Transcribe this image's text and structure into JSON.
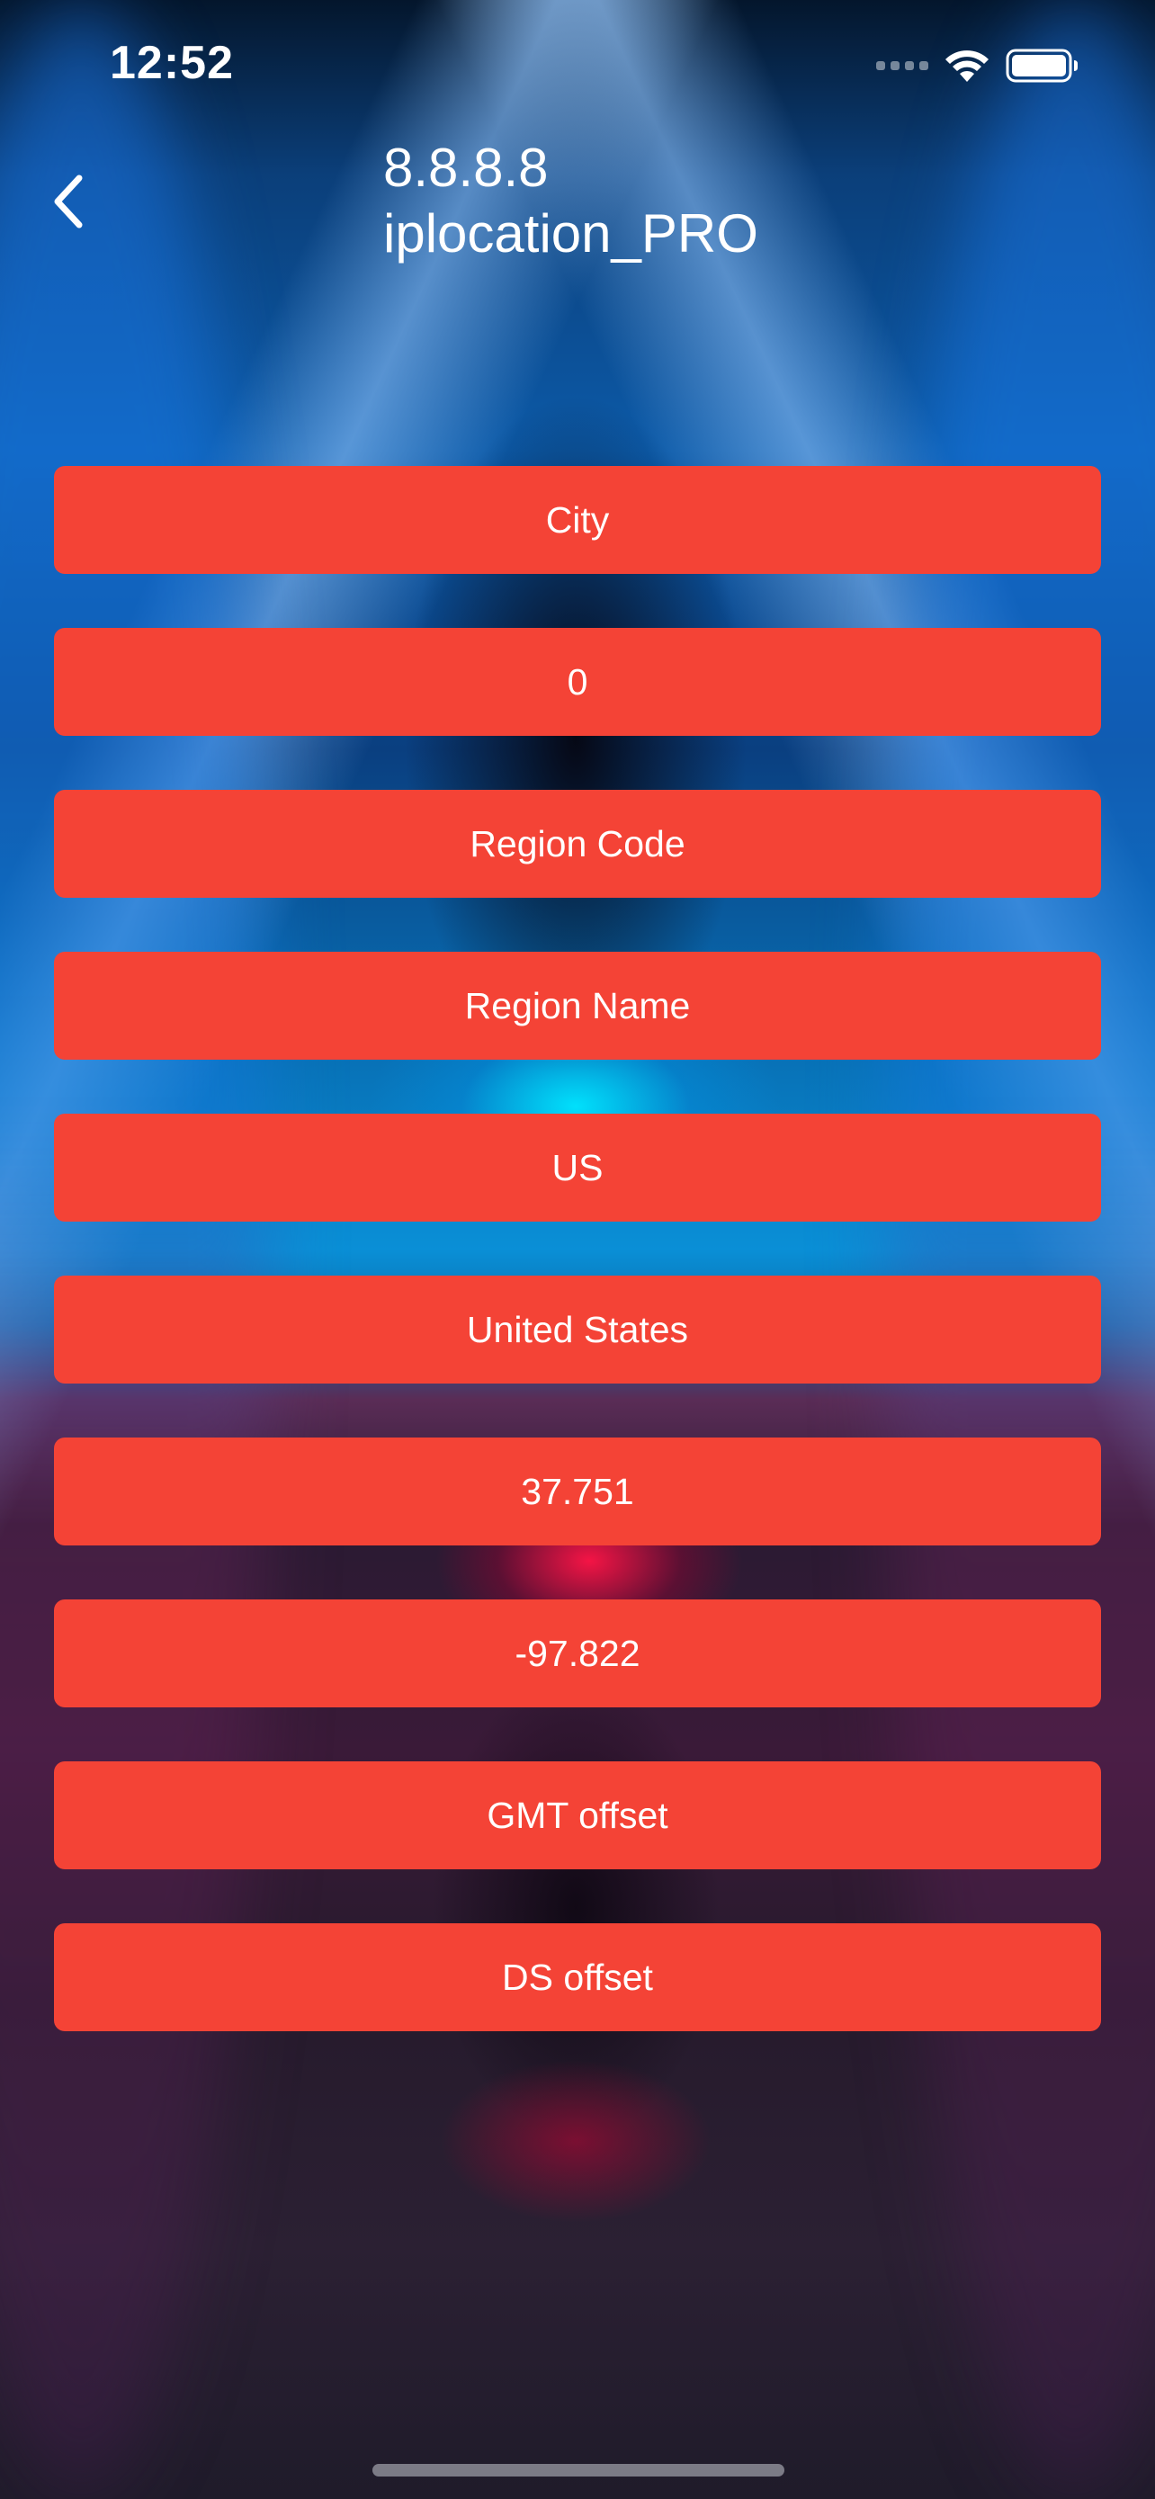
{
  "status_bar": {
    "time": "12:52",
    "icons": [
      "signal-icon",
      "wifi-icon",
      "battery-icon"
    ]
  },
  "header": {
    "back_icon": "chevron-left-icon",
    "title_line1": "8.8.8.8",
    "title_line2": "iplocation_PRO"
  },
  "items": [
    {
      "label": "City"
    },
    {
      "label": "0"
    },
    {
      "label": "Region Code"
    },
    {
      "label": "Region Name"
    },
    {
      "label": "US"
    },
    {
      "label": "United States"
    },
    {
      "label": "37.751"
    },
    {
      "label": "-97.822"
    },
    {
      "label": "GMT offset"
    },
    {
      "label": "DS offset"
    }
  ],
  "colors": {
    "button_background": "#f44336",
    "button_text": "#ffffff",
    "header_text": "#ffffff"
  }
}
